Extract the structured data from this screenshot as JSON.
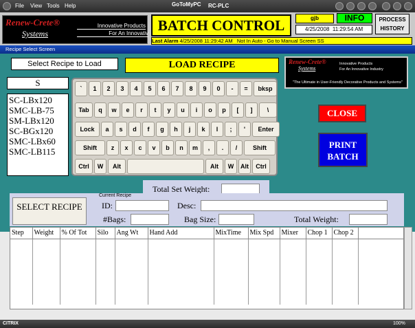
{
  "titlebar": {
    "menus": [
      "File",
      "View",
      "Tools",
      "Help"
    ],
    "brand": "GoToMyPC",
    "connection": "RC-PLC"
  },
  "header": {
    "logo": {
      "brand_line1": "Renew-Crete®",
      "brand_line2": "Systems",
      "tag1": "Innovative Products",
      "tag2": "For An Innovativ"
    },
    "title": "BATCH CONTROL",
    "user": "gjb",
    "info_button": "INFO",
    "date": "4/25/2008",
    "time": "11:29:54 AM",
    "process_history_button": "PROCESS HISTORY",
    "alarm_label": "Last Alarm",
    "alarm_date": "4/25/2008",
    "alarm_time": "11:29:42 AM",
    "alarm_text": "Not In Auto - Go to Manual Screen SS"
  },
  "window_label": "Recipe Select Screen",
  "recipe_select": {
    "select_label": "Select Recipe to Load",
    "load_button": "LOAD RECIPE",
    "filter_value": "S",
    "recipes": [
      "SC-LBx120",
      "SMC-LB-75",
      "SM-LBx120",
      "SC-BGx120",
      "SMC-LBx60",
      "SMC-LB115"
    ]
  },
  "logo2": {
    "brand_line1": "Renew-Crete®",
    "brand_line2": "Systems",
    "tag1": "Innovative Products",
    "tag2": "For An Innovative Industry",
    "slogan": "\"The Ultimate in User-Friendly Decorative Products and Systems\""
  },
  "keyboard": {
    "rows": [
      [
        "`",
        "1",
        "2",
        "3",
        "4",
        "5",
        "6",
        "7",
        "8",
        "9",
        "0",
        "-",
        "=",
        "bksp"
      ],
      [
        "Tab",
        "q",
        "w",
        "e",
        "r",
        "t",
        "y",
        "u",
        "i",
        "o",
        "p",
        "[",
        "]",
        "\\"
      ],
      [
        "Lock",
        "a",
        "s",
        "d",
        "f",
        "g",
        "h",
        "j",
        "k",
        "l",
        ";",
        "'",
        "Enter"
      ],
      [
        "Shift",
        "z",
        "x",
        "c",
        "v",
        "b",
        "n",
        "m",
        ",",
        ".",
        "/",
        "Shift"
      ],
      [
        "Ctrl",
        "W",
        "Alt",
        "",
        "Alt",
        "W",
        "Alt",
        "Ctrl"
      ]
    ]
  },
  "actions": {
    "close": "CLOSE",
    "print_batch": "PRINT BATCH"
  },
  "current_recipe": {
    "total_set_weight_label": "Total Set Weight:",
    "total_set_weight_value": "",
    "select_recipe_button": "SELECT RECIPE",
    "section_label": "Current Recipe",
    "id_label": "ID:",
    "id_value": "",
    "desc_label": "Desc:",
    "desc_value": "",
    "bags_label": "#Bags:",
    "bags_value": "",
    "bag_size_label": "Bag Size:",
    "bag_size_value": "",
    "total_weight_label": "Total Weight:",
    "total_weight_value": ""
  },
  "table": {
    "columns": [
      "Step",
      "Weight",
      "% Of Tot",
      "Silo",
      "Ang Wt",
      "Hand Add",
      "MixTime",
      "Mix Spd",
      "Mixer",
      "Chop 1",
      "Chop 2"
    ],
    "rows": []
  },
  "statusbar": {
    "left": "CITRIX",
    "zoom": "100%"
  }
}
